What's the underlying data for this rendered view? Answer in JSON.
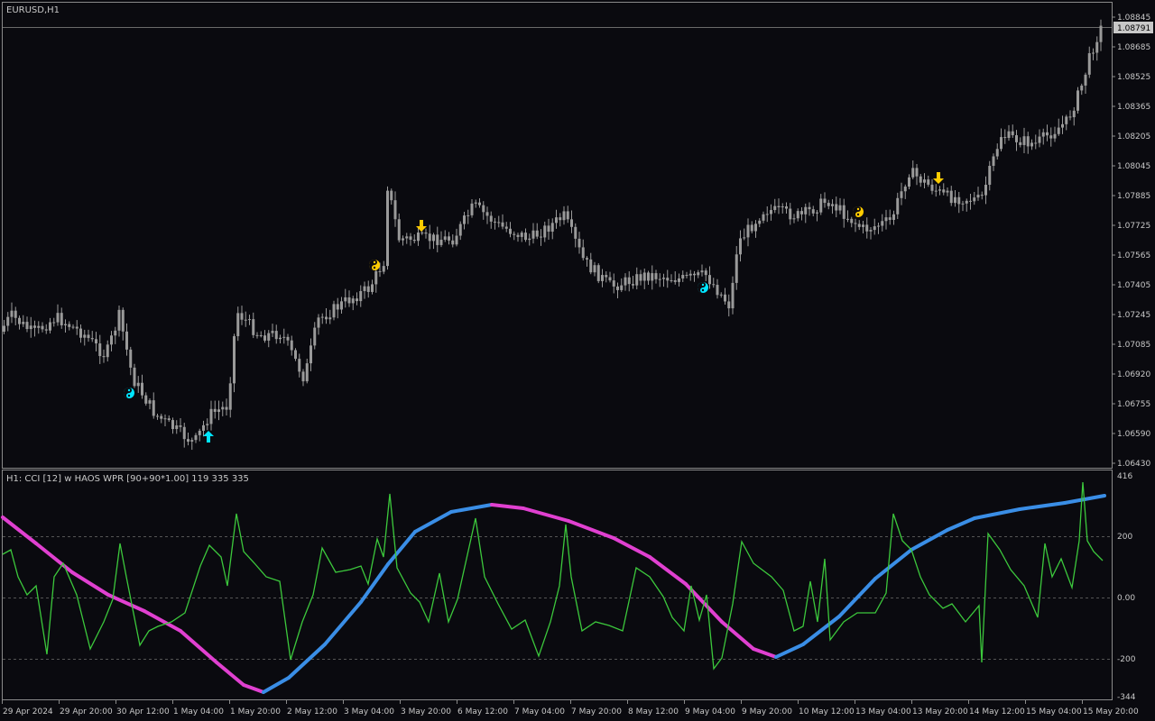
{
  "main_chart": {
    "title": "EURUSD,H1",
    "current_price": "1.08791",
    "price_labels": [
      "1.08845",
      "1.08685",
      "1.08525",
      "1.08365",
      "1.08205",
      "1.08045",
      "1.07885",
      "1.07725",
      "1.07565",
      "1.07405",
      "1.07245",
      "1.07085",
      "1.06920",
      "1.06755",
      "1.06590",
      "1.06430"
    ],
    "colors": {
      "background": "#0a0a0f",
      "candle": "#9a9a9a",
      "buy_arrow": "#00e5ff",
      "sell_arrow": "#ffcc00",
      "axis": "#8a8a8a"
    },
    "signals": [
      {
        "type": "yinyang",
        "color": "cyan",
        "icon": "yin-yang-icon"
      },
      {
        "type": "arrow-up",
        "color": "cyan",
        "icon": "arrow-up-icon"
      },
      {
        "type": "yinyang",
        "color": "gold",
        "icon": "yin-yang-icon"
      },
      {
        "type": "arrow-down",
        "color": "gold",
        "icon": "arrow-down-icon"
      },
      {
        "type": "yinyang",
        "color": "cyan",
        "icon": "yin-yang-icon"
      },
      {
        "type": "yinyang",
        "color": "gold",
        "icon": "yin-yang-icon"
      },
      {
        "type": "arrow-down",
        "color": "gold",
        "icon": "arrow-down-icon"
      }
    ]
  },
  "indicator": {
    "title": "H1: CCI [12] w HAOS WPR [90+90*1.00] 119 335 335",
    "levels": [
      "416",
      "200",
      "0.00",
      "-200",
      "-344"
    ],
    "colors": {
      "cci": "#3cc83c",
      "trend_up": "#3a8ee6",
      "trend_down": "#e040d0",
      "level_line": "#555555"
    }
  },
  "time_axis": {
    "labels": [
      "29 Apr 2024",
      "29 Apr 20:00",
      "30 Apr 12:00",
      "1 May 04:00",
      "1 May 20:00",
      "2 May 12:00",
      "3 May 04:00",
      "3 May 20:00",
      "6 May 12:00",
      "7 May 04:00",
      "7 May 20:00",
      "8 May 12:00",
      "9 May 04:00",
      "9 May 20:00",
      "10 May 12:00",
      "13 May 04:00",
      "13 May 20:00",
      "14 May 12:00",
      "15 May 04:00",
      "15 May 20:00"
    ]
  }
}
